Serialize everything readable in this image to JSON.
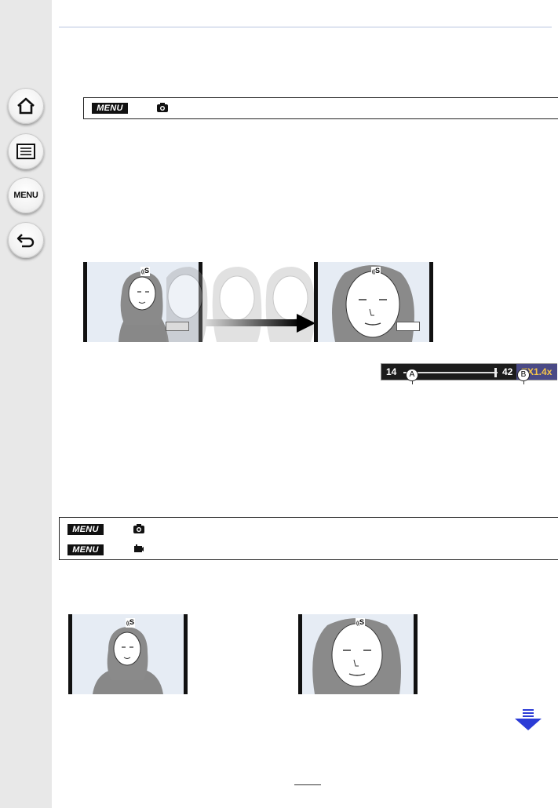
{
  "menu_path_1": {
    "badge": "MENU",
    "icon": "camera-icon"
  },
  "menu_path_2": {
    "rows": [
      {
        "badge": "MENU",
        "icon": "camera-icon"
      },
      {
        "badge": "MENU",
        "icon": "video-camera-icon"
      }
    ]
  },
  "sidebar": {
    "home": {
      "icon": "home-icon"
    },
    "contents": {
      "icon": "list-icon"
    },
    "menu": {
      "label": "MENU"
    },
    "back": {
      "icon": "back-arrow-icon"
    }
  },
  "zoom_bar": {
    "wide_value": "14",
    "tele_value": "42",
    "ex_label": "EX1.4x",
    "callout_a": "A",
    "callout_b": "B"
  },
  "panel_marks": {
    "stabilizer": "S",
    "prefix": "(("
  },
  "colors": {
    "accent": "#2b3bd6",
    "sidebar": "#e8e8e8",
    "zoom_bar_ex": "#4a4a86"
  }
}
